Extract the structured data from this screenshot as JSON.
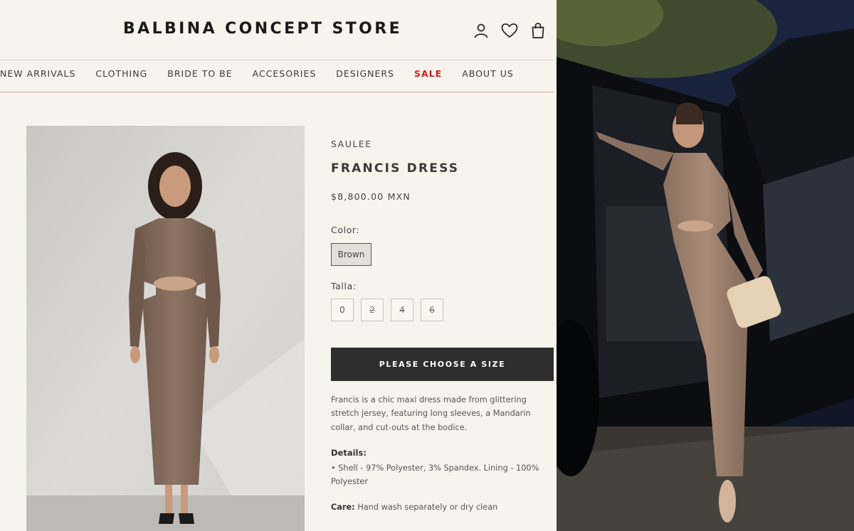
{
  "header": {
    "logo": "BALBINA CONCEPT STORE",
    "icons": [
      "account-icon",
      "wishlist-heart-icon",
      "shopping-bag-icon"
    ]
  },
  "nav": {
    "items": [
      "NEW ARRIVALS",
      "CLOTHING",
      "BRIDE TO BE",
      "ACCESORIES",
      "DESIGNERS",
      "SALE",
      "ABOUT US"
    ],
    "sale_color": "#d0191c"
  },
  "product": {
    "brand": "SAULEE",
    "title": "FRANCIS DRESS",
    "price": "$8,800.00 MXN",
    "color_label": "Color:",
    "color_value": "Brown",
    "size_label": "Talla:",
    "sizes": [
      "0",
      "2",
      "4",
      "6"
    ],
    "cta": "PLEASE CHOOSE A SIZE",
    "description": "Francis is a chic maxi dress made from glittering stretch jersey, featuring long sleeves, a Mandarin collar, and cut-outs at the bodice.",
    "details_label": "Details:",
    "details_text": "• Shell - 97% Polyester, 3% Spandex. Lining - 100% Polyester",
    "care_label": "Care:",
    "care_text": " Hand wash separately or dry clean"
  }
}
